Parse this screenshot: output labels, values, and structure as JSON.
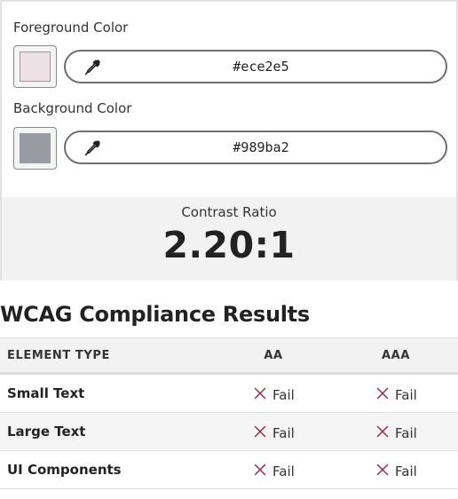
{
  "foreground": {
    "label": "Foreground Color",
    "hex": "#ece2e5",
    "swatch_color": "#ece2e5",
    "tool_icon": "eyedropper-icon"
  },
  "background": {
    "label": "Background Color",
    "hex": "#989ba2",
    "swatch_color": "#989ba2",
    "tool_icon": "eyedropper-icon"
  },
  "contrast": {
    "label": "Contrast Ratio",
    "value": "2.20:1"
  },
  "results": {
    "title": "WCAG Compliance Results",
    "headers": [
      "ELEMENT TYPE",
      "AA",
      "AAA"
    ],
    "rows": [
      {
        "element": "Small Text",
        "aa": "Fail",
        "aaa": "Fail"
      },
      {
        "element": "Large Text",
        "aa": "Fail",
        "aaa": "Fail"
      },
      {
        "element": "UI Components",
        "aa": "Fail",
        "aaa": "Fail"
      }
    ],
    "fail_icon": "x-icon",
    "fail_color": "#9c2a4a"
  }
}
